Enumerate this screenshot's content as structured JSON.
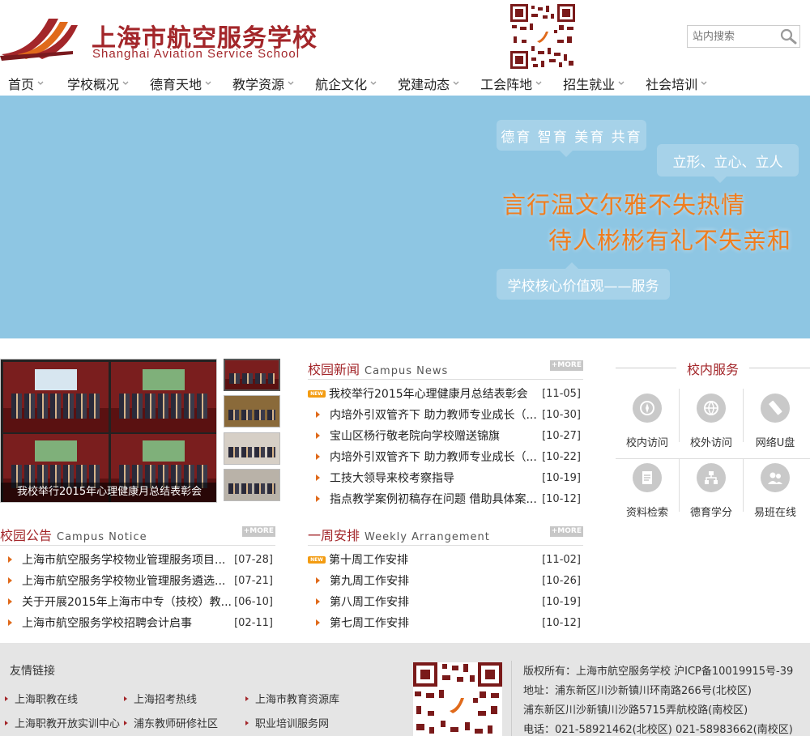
{
  "header": {
    "logo_cn": "上海市航空服务学校",
    "logo_en": "Shanghai Aviation Service School",
    "search_placeholder": "站内搜索"
  },
  "nav": [
    {
      "label": "首页"
    },
    {
      "label": "学校概况"
    },
    {
      "label": "德育天地"
    },
    {
      "label": "教学资源"
    },
    {
      "label": "航企文化"
    },
    {
      "label": "党建动态"
    },
    {
      "label": "工会阵地"
    },
    {
      "label": "招生就业"
    },
    {
      "label": "社会培训"
    }
  ],
  "banner": {
    "bubble1": "德育 智育 美育 共育",
    "bubble2": "立形、立心、立人",
    "slogan1": "言行温文尔雅不失热情",
    "slogan2": "待人彬彬有礼不失亲和",
    "bubble3": "学校核心价值观——服务"
  },
  "gallery": {
    "caption": "我校举行2015年心理健康月总结表彰会"
  },
  "news": {
    "title_cn": "校园新闻",
    "title_en": "Campus News",
    "more": "+MORE",
    "items": [
      {
        "title": "我校举行2015年心理健康月总结表彰会",
        "date": "[11-05]",
        "is_new": true
      },
      {
        "title": "内培外引双管齐下 助力教师专业成长（...",
        "date": "[10-30]"
      },
      {
        "title": "宝山区杨行敬老院向学校赠送锦旗",
        "date": "[10-27]"
      },
      {
        "title": "内培外引双管齐下 助力教师专业成长（...",
        "date": "[10-22]"
      },
      {
        "title": "工技大领导来校考察指导",
        "date": "[10-19]"
      },
      {
        "title": "指点教学案例初稿存在问题 借助具体案...",
        "date": "[10-12]"
      }
    ]
  },
  "notice": {
    "title_cn": "校园公告",
    "title_en": "Campus Notice",
    "more": "+MORE",
    "items": [
      {
        "title": "上海市航空服务学校物业管理服务项目...",
        "date": "[07-28]"
      },
      {
        "title": "上海市航空服务学校物业管理服务遴选...",
        "date": "[07-21]"
      },
      {
        "title": "关于开展2015年上海市中专（技校）教...",
        "date": "[06-10]"
      },
      {
        "title": "上海市航空服务学校招聘会计启事",
        "date": "[02-11]"
      }
    ]
  },
  "weekly": {
    "title_cn": "一周安排",
    "title_en": "Weekly Arrangement",
    "more": "+MORE",
    "items": [
      {
        "title": "第十周工作安排",
        "date": "[11-02]",
        "is_new": true
      },
      {
        "title": "第九周工作安排",
        "date": "[10-26]"
      },
      {
        "title": "第八周工作安排",
        "date": "[10-19]"
      },
      {
        "title": "第七周工作安排",
        "date": "[10-12]"
      }
    ]
  },
  "services": {
    "title": "校内服务",
    "items": [
      {
        "label": "校内访问",
        "icon": "compass-icon"
      },
      {
        "label": "校外访问",
        "icon": "globe-icon"
      },
      {
        "label": "网络U盘",
        "icon": "usb-drive-icon"
      },
      {
        "label": "资料检索",
        "icon": "document-icon"
      },
      {
        "label": "德育学分",
        "icon": "org-chart-icon"
      },
      {
        "label": "易班在线",
        "icon": "users-icon"
      }
    ]
  },
  "new_badge": "NEW",
  "footer": {
    "links_title": "友情链接",
    "links": [
      "上海职教在线",
      "上海招考热线",
      "上海市教育资源库",
      "上海职教开放实训中心",
      "浦东教师研修社区",
      "职业培训服务网"
    ],
    "info": [
      "版权所有：上海市航空服务学校    沪ICP备10019915号-39",
      "地址：浦东新区川沙新镇川环南路266号(北校区)",
      "浦东新区川沙新镇川沙路5715弄航校路(南校区)",
      "电话：021-58921462(北校区) 021-58983662(南校区)"
    ]
  },
  "colors": {
    "brand": "#a3262a",
    "accent": "#e06a1b",
    "banner_bg": "#8ec6e3",
    "slogan": "#f07d1e"
  }
}
